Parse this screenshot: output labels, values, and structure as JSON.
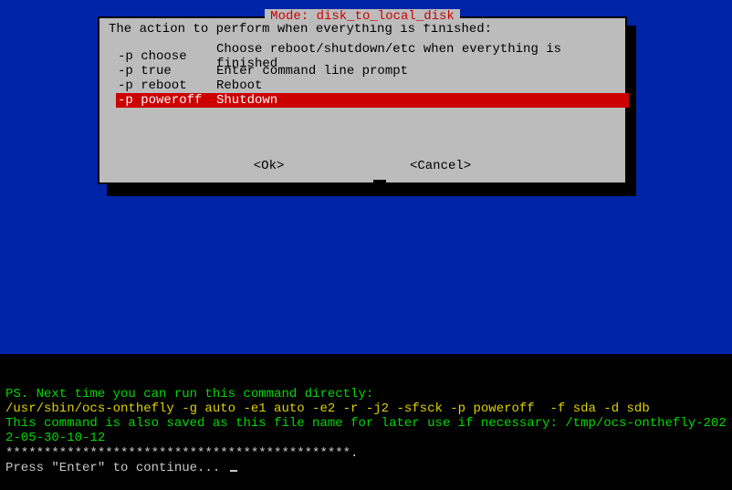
{
  "dialog": {
    "title": "Mode: disk_to_local_disk",
    "prompt": "The action to perform when everything is finished:",
    "selected_index": 3,
    "options": [
      {
        "flag": "-p choose",
        "desc": "Choose reboot/shutdown/etc when everything is finished"
      },
      {
        "flag": "-p true",
        "desc": "Enter command line prompt"
      },
      {
        "flag": "-p reboot",
        "desc": "Reboot"
      },
      {
        "flag": "-p poweroff",
        "desc": "Shutdown"
      }
    ],
    "ok_label": "<Ok>",
    "cancel_label": "<Cancel>"
  },
  "terminal": {
    "line1": "PS. Next time you can run this command directly:",
    "line2": "/usr/sbin/ocs-onthefly -g auto -e1 auto -e2 -r -j2 -sfsck -p poweroff  -f sda -d sdb",
    "line3": "This command is also saved as this file name for later use if necessary: /tmp/ocs-onthefly-2022-05-30-10-12",
    "line4": "*********************************************.",
    "line5": "Press \"Enter\" to continue... "
  }
}
